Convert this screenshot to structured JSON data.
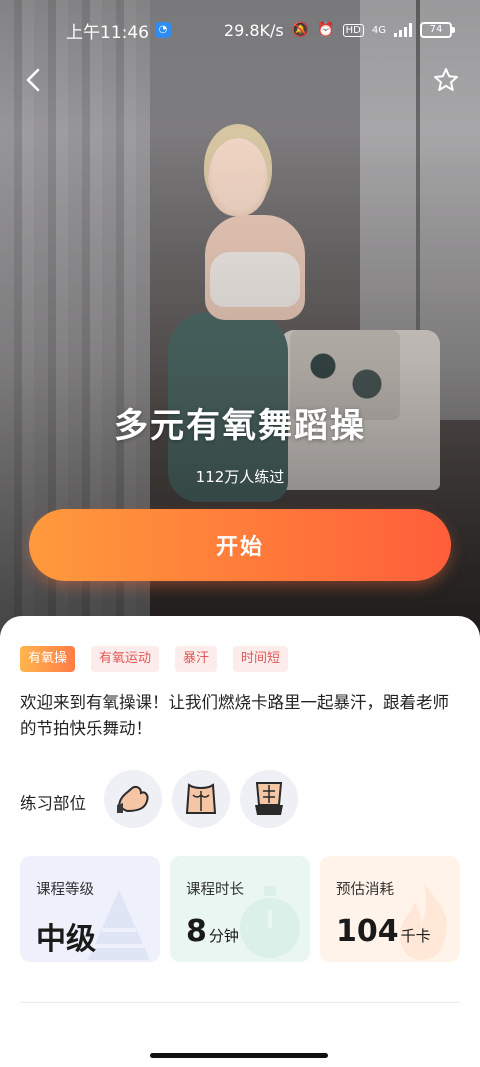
{
  "status_bar": {
    "time": "上午11:46",
    "speed": "29.8K/s",
    "network": "4G",
    "hd_label": "HD",
    "battery": "74"
  },
  "hero": {
    "title": "多元有氧舞蹈操",
    "practiced": "112万人练过",
    "start_label": "开始"
  },
  "tags": [
    "有氧操",
    "有氧运动",
    "暴汗",
    "时间短"
  ],
  "description": "欢迎来到有氧操课！让我们燃烧卡路里一起暴汗，跟着老师的节拍快乐舞动！",
  "parts": {
    "label": "练习部位",
    "items": [
      "arm-icon",
      "chest-icon",
      "abs-icon"
    ]
  },
  "stats": {
    "level": {
      "label": "课程等级",
      "value": "中级"
    },
    "duration": {
      "label": "课程时长",
      "value": "8",
      "unit": "分钟"
    },
    "calorie": {
      "label": "预估消耗",
      "value": "104",
      "unit": "千卡"
    }
  },
  "colors": {
    "accent_start": "#ff9a3c",
    "accent_end": "#ff5e3a",
    "tag_text": "#e05858"
  }
}
